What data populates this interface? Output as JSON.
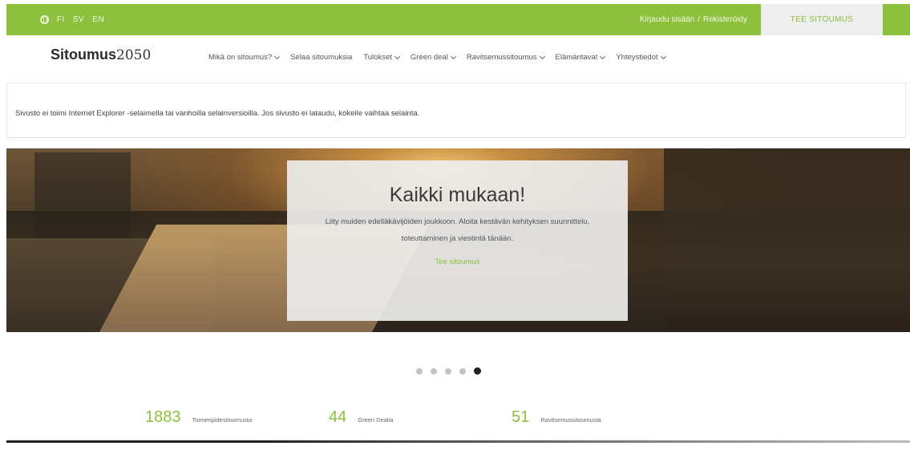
{
  "colors": {
    "brand_green": "#8cc03d"
  },
  "topbar": {
    "globe_icon": "globe-icon",
    "languages": [
      "FI",
      "SV",
      "EN"
    ],
    "login_label": "Kirjaudu sisään",
    "login_separator": "/",
    "register_label": "Rekisteröidy",
    "cta_label": "TEE SITOUMUS"
  },
  "nav": {
    "logo_word": "Sitoumus",
    "logo_number": "2050",
    "items": [
      {
        "label": "Mikä on sitoumus?",
        "has_dropdown": true
      },
      {
        "label": "Selaa sitoumuksia",
        "has_dropdown": false
      },
      {
        "label": "Tulokset",
        "has_dropdown": true
      },
      {
        "label": "Green deal",
        "has_dropdown": true
      },
      {
        "label": "Ravitsemussitoumus",
        "has_dropdown": true
      },
      {
        "label": "Elämäntavat",
        "has_dropdown": true
      },
      {
        "label": "Yhteystiedot",
        "has_dropdown": true
      }
    ]
  },
  "notice": {
    "text": "Sivusto ei toimi Internet Explorer -selaimella tai vanhoilla selainversioilla. Jos sivusto ei lataudu, kokeile vaihtaa selainta."
  },
  "hero": {
    "title": "Kaikki mukaan!",
    "text": "Liity muiden edelläkävijöiden joukkoon. Aloita kestävän kehityksen suunnittelu, toteuttaminen ja viestintä tänään.",
    "link_label": "Tee sitoumus"
  },
  "carousel": {
    "count": 5,
    "active_index": 4
  },
  "stats": [
    {
      "value": "1883",
      "label": "Toimenpidesitoumusta"
    },
    {
      "value": "44",
      "label": "Green Dealia"
    },
    {
      "value": "51",
      "label": "Ravitsemussitoumusta"
    }
  ]
}
